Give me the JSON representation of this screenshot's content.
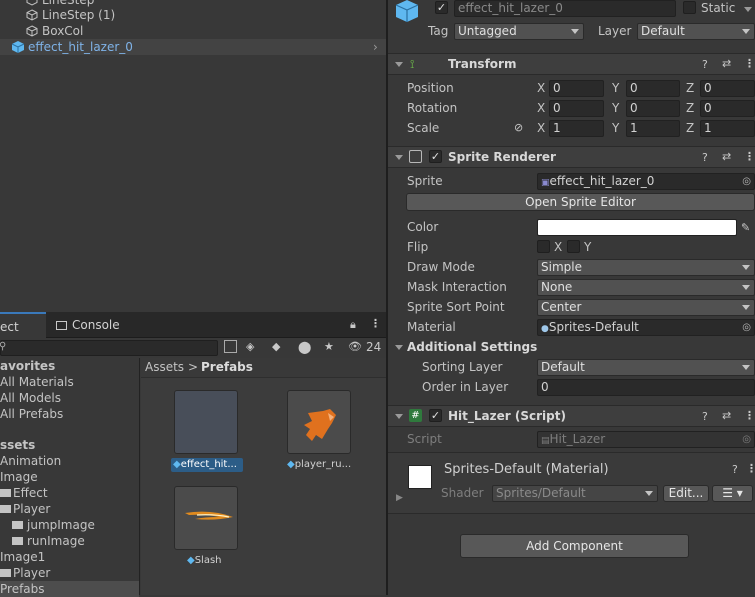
{
  "hierarchy": {
    "items": [
      {
        "label": "LineStep"
      },
      {
        "label": "LineStep (1)"
      },
      {
        "label": "BoxCol"
      },
      {
        "label": "effect_hit_lazer_0"
      }
    ]
  },
  "bottom_panel": {
    "tabs": [
      {
        "label": "ect"
      },
      {
        "label": "Console"
      }
    ],
    "search_placeholder": "",
    "hidden_count": "24",
    "breadcrumb": {
      "root": "Assets",
      "separator": ">",
      "current": "Prefabs"
    },
    "tree": [
      {
        "label": "avorites"
      },
      {
        "label": "All Materials"
      },
      {
        "label": "All Models"
      },
      {
        "label": "All Prefabs"
      },
      {
        "label": "ssets"
      },
      {
        "label": "Animation"
      },
      {
        "label": "Image"
      },
      {
        "label": "Effect"
      },
      {
        "label": "Player"
      },
      {
        "label": "jumpImage"
      },
      {
        "label": "runImage"
      },
      {
        "label": "Image1"
      },
      {
        "label": "Player"
      },
      {
        "label": "Prefabs"
      }
    ],
    "assets": [
      {
        "label": "effect_hit..."
      },
      {
        "label": "player_ru..."
      },
      {
        "label": "Slash"
      }
    ]
  },
  "inspector": {
    "object_name": "effect_hit_lazer_0",
    "static_label": "Static",
    "tag_label": "Tag",
    "tag_value": "Untagged",
    "layer_label": "Layer",
    "layer_value": "Default",
    "transform": {
      "title": "Transform",
      "rows": [
        {
          "label": "Position",
          "x": "0",
          "y": "0",
          "z": "0"
        },
        {
          "label": "Rotation",
          "x": "0",
          "y": "0",
          "z": "0"
        },
        {
          "label": "Scale",
          "x": "1",
          "y": "1",
          "z": "1"
        }
      ],
      "axis_x": "X",
      "axis_y": "Y",
      "axis_z": "Z"
    },
    "sprite_renderer": {
      "title": "Sprite Renderer",
      "sprite_label": "Sprite",
      "sprite_value": "effect_hit_lazer_0",
      "open_editor": "Open Sprite Editor",
      "color_label": "Color",
      "color_value": "#ffffff",
      "flip_label": "Flip",
      "flip_x": "X",
      "flip_y": "Y",
      "draw_mode_label": "Draw Mode",
      "draw_mode_value": "Simple",
      "mask_label": "Mask Interaction",
      "mask_value": "None",
      "sort_point_label": "Sprite Sort Point",
      "sort_point_value": "Center",
      "material_label": "Material",
      "material_value": "Sprites-Default",
      "additional_label": "Additional Settings",
      "sorting_layer_label": "Sorting Layer",
      "sorting_layer_value": "Default",
      "order_label": "Order in Layer",
      "order_value": "0"
    },
    "script_component": {
      "title": "Hit_Lazer (Script)",
      "script_label": "Script",
      "script_value": "Hit_Lazer"
    },
    "material": {
      "title": "Sprites-Default (Material)",
      "shader_label": "Shader",
      "shader_value": "Sprites/Default",
      "edit_label": "Edit..."
    },
    "add_component": "Add Component"
  }
}
